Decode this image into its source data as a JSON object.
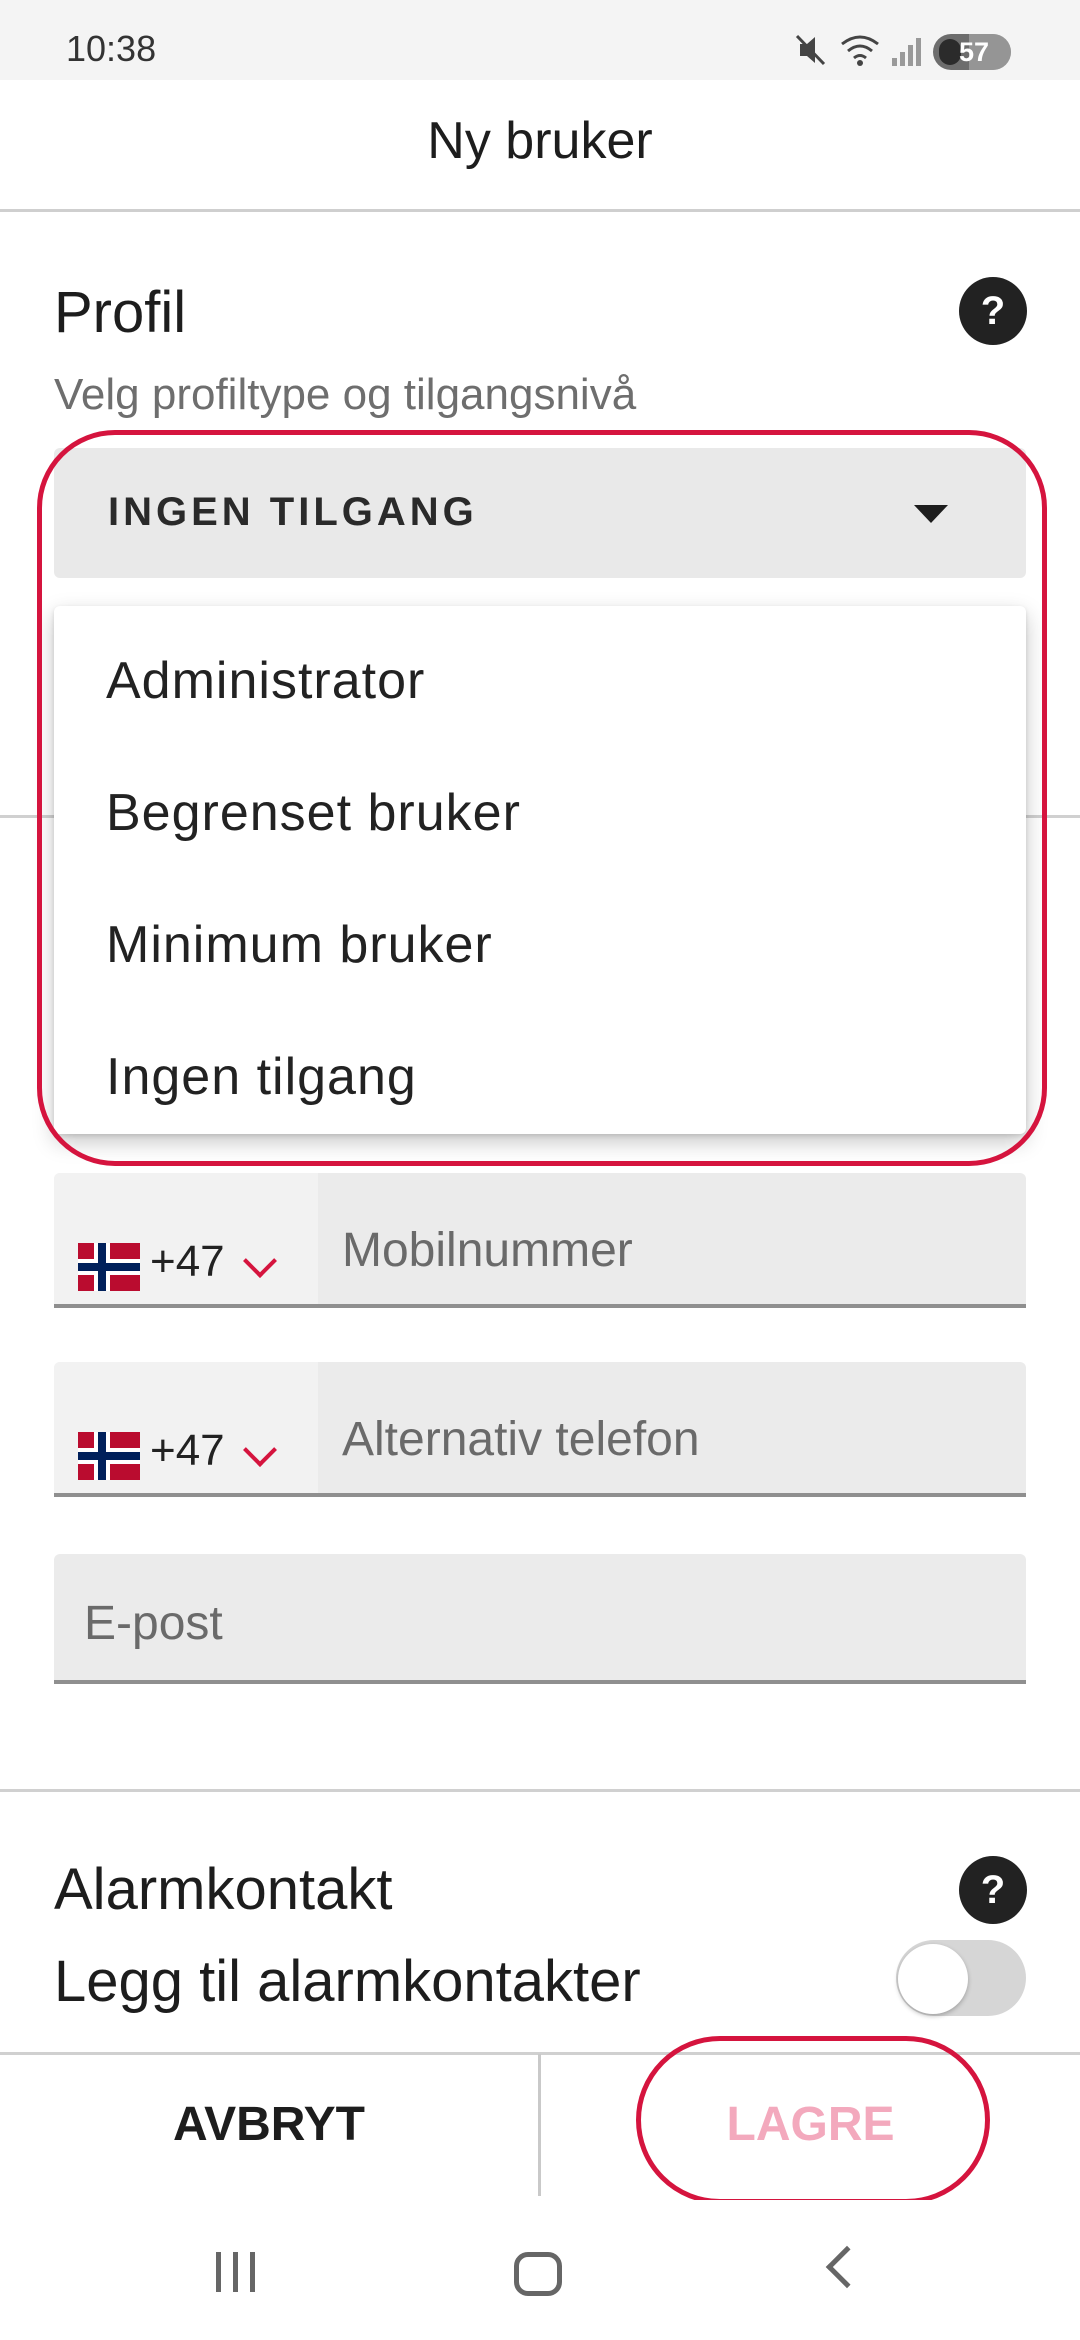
{
  "status_bar": {
    "time": "10:38",
    "icons": [
      "mute-icon",
      "wifi-icon",
      "signal-icon"
    ],
    "battery": "57"
  },
  "header": {
    "title": "Ny bruker"
  },
  "profile": {
    "title": "Profil",
    "subtitle": "Velg profiltype og tilgangsnivå",
    "help_label": "?",
    "selected_value": "INGEN TILGANG",
    "options": [
      "Administrator",
      "Begrenset bruker",
      "Minimum bruker",
      "Ingen tilgang"
    ]
  },
  "contact": {
    "phone_prefix": "+47",
    "phone_placeholder": "Mobilnummer",
    "alt_prefix": "+47",
    "alt_placeholder": "Alternativ telefon",
    "email_placeholder": "E-post"
  },
  "alarm": {
    "title": "Alarmkontakt",
    "help_label": "?",
    "toggle_label": "Legg til alarmkontakter",
    "toggle_on": false
  },
  "actions": {
    "cancel_label": "AVBRYT",
    "save_label": "LAGRE"
  },
  "colors": {
    "accent": "#d5143e",
    "save_disabled": "#f3a9bd"
  }
}
